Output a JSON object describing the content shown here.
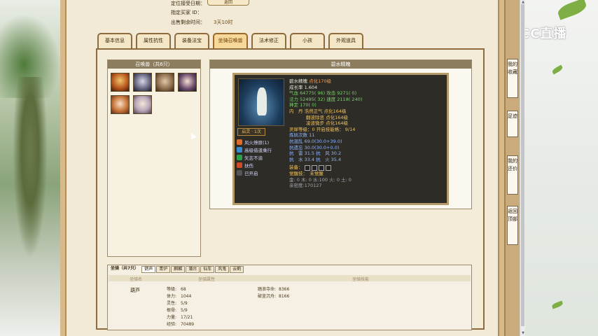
{
  "header_info": {
    "date_label": "定位接受日期：",
    "seller_id_label": "指定买家 ID：",
    "time_left_label": "出售剩余时间：",
    "time_left_value": "3天10时",
    "top_button": "返回"
  },
  "tabs": [
    "基本信息",
    "属性抗性",
    "装备法宝",
    "坐骑召唤兽",
    "法术修正",
    "小孩",
    "外观道具"
  ],
  "active_tab": "坐骑召唤兽",
  "pet_panel": {
    "title": "召唤兽（共6只）"
  },
  "detail_panel": {
    "title": "碧水精魄"
  },
  "pet_card": {
    "name": "碧水精魄",
    "tag": "点化170级",
    "growth": "成长率 1.604",
    "hp": "气血 64775( 96) 攻击 9271( 0)",
    "mp": "法力 52495( 32) 速度 2118( 240)",
    "spirit": "神定 170( 0)",
    "neidan_1": "内　丹 浩然正气 点化164级",
    "neidan_2": "翻波除恶 点化164级",
    "neidan_3": "凌波微步 点化164级",
    "skill_level": "灵犀等级：0 开启技能格： 9/14",
    "rebirth": "炼妖次数 11",
    "res_block": "抗混乱 69.0(30.0+39.0)",
    "res_seal": "抗遗忘 30.0(30.0+0.0)",
    "res_1": "抗　雷 31.5 抗　风 30.2",
    "res_2": "抗　水 33.4 抗　火 35.4",
    "equip_label": "装备：",
    "awaken": "觉醒技：　未觉醒",
    "elements": "金: 0 木: 0 水:100 火: 0 土: 0",
    "intimacy": "亲密度:170127",
    "badge": "启灵 · 1次",
    "skills": [
      {
        "name": "风火燎原(1)",
        "color": "#e06a2a"
      },
      {
        "name": "高级借道乘行",
        "color": "#3a8ad0"
      },
      {
        "name": "矢志不渝",
        "color": "#2aa04a"
      },
      {
        "name": "扶伤",
        "color": "#d04a2a"
      },
      {
        "name": "已开启",
        "color": "#555555"
      }
    ]
  },
  "bottom": {
    "mount_count": "坐骑（共7只）",
    "mount_tabs": [
      "鹦声",
      "青炉",
      "麒麟",
      "蒲台",
      "仙车",
      "风鬼",
      "云鹤"
    ],
    "active_mount_tab": "鹦声",
    "col_name": "坐骑名",
    "col_attr": "坐骑属性",
    "col_skill": "坐骑技能",
    "mount_name": "葫芦",
    "attrs": [
      {
        "label": "等级:",
        "value": "68"
      },
      {
        "label": "体力:",
        "value": "1044"
      },
      {
        "label": "灵性:",
        "value": "5/9"
      },
      {
        "label": "根骨:",
        "value": "5/9"
      },
      {
        "label": "力量:",
        "value": "17/21"
      },
      {
        "label": "经验:",
        "value": "70489"
      }
    ],
    "mount_skills": [
      {
        "label": "踏浪寺命:",
        "value": "8366"
      },
      {
        "label": "破釜沉舟:",
        "value": "8166"
      }
    ]
  },
  "side_buttons": [
    "我的收藏",
    "足迹",
    "我的还价",
    "返回顶部"
  ],
  "cc_logo": "CC直播"
}
